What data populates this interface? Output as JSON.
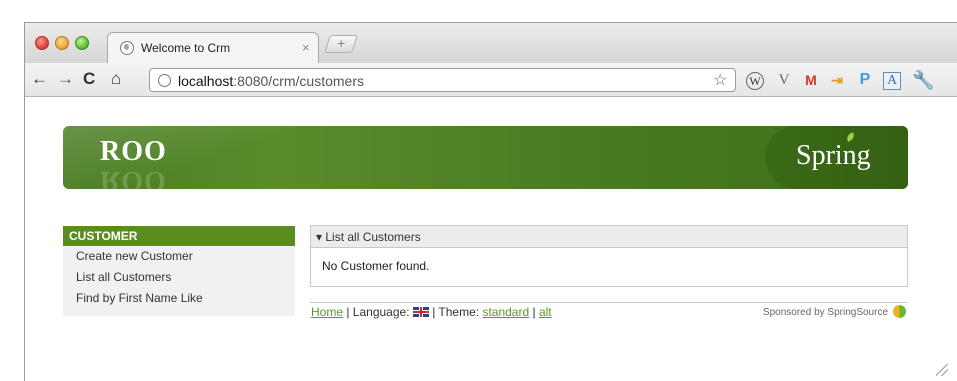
{
  "browser": {
    "tab": {
      "title": "Welcome to Crm",
      "close_glyph": "×"
    },
    "new_tab_glyph": "+",
    "nav": {
      "back": "←",
      "forward": "→",
      "reload": "C",
      "home": "⌂"
    },
    "address": {
      "host": "localhost",
      "rest": ":8080/crm/customers"
    },
    "star_glyph": "☆",
    "extensions": {
      "w": "W",
      "v": "V",
      "gmail": "M",
      "p": "P",
      "a": "A",
      "wrench": "🔧",
      "plug": "⇥"
    }
  },
  "banner": {
    "logo": "ROO",
    "brand": "Spring"
  },
  "menu": {
    "heading": "CUSTOMER",
    "items": [
      {
        "label": "Create new Customer"
      },
      {
        "label": "List all Customers"
      },
      {
        "label": "Find by First Name Like"
      }
    ]
  },
  "panel": {
    "title": "▾ List all Customers",
    "message": "No Customer found."
  },
  "footer": {
    "home": "Home",
    "language_label": " | Language: ",
    "theme_label": " | Theme: ",
    "theme_standard": "standard",
    "separator": " | ",
    "theme_alt": "alt",
    "sponsor": "Sponsored by SpringSource"
  },
  "colors": {
    "accent_green": "#5a8c1f",
    "link_green": "#5c9a1c"
  }
}
